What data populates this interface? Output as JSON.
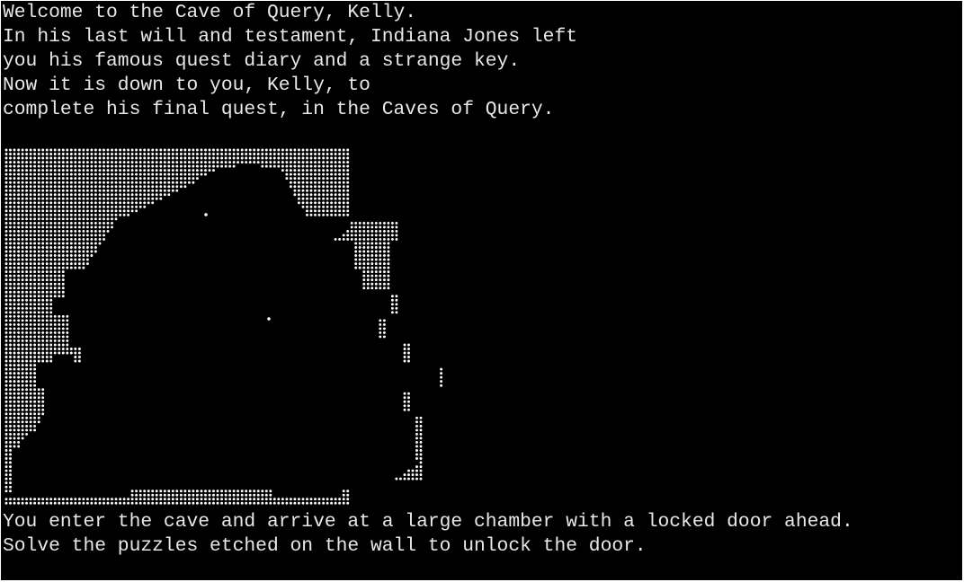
{
  "intro_lines": [
    "Welcome to the Cave of Query, Kelly.",
    "In his last will and testament, Indiana Jones left",
    "you his famous quest diary and a strange key.",
    "Now it is down to you, Kelly, to",
    "complete his final quest, in the Caves of Query."
  ],
  "outro_lines": [
    "You enter the cave and arrive at a large chamber with a locked door ahead.",
    "Solve the puzzles etched on the wall to unlock the door."
  ],
  "colors": {
    "background": "#000000",
    "text": "#e8e8e8",
    "dots": "#ffffff"
  },
  "cave_map": {
    "description_icon": "dotted-ascii-cave-map"
  }
}
